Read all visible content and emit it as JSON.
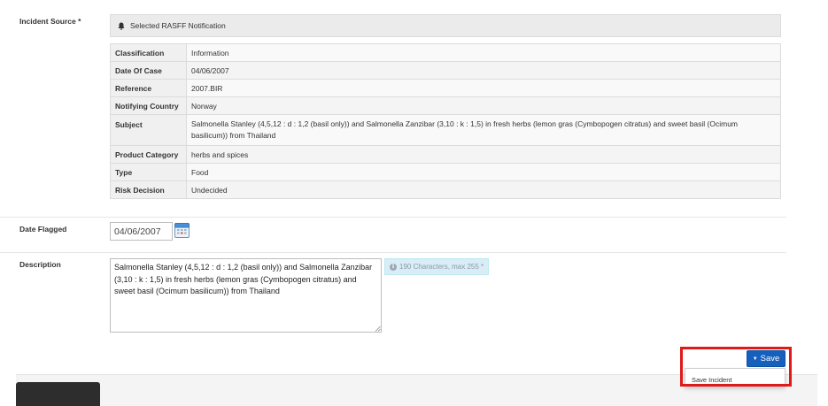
{
  "incident_source": {
    "label": "Incident Source *",
    "panel_title": "Selected RASFF Notification",
    "rows": [
      {
        "key": "Classification",
        "value": "Information"
      },
      {
        "key": "Date Of Case",
        "value": "04/06/2007"
      },
      {
        "key": "Reference",
        "value": "2007.BIR"
      },
      {
        "key": "Notifying Country",
        "value": "Norway"
      },
      {
        "key": "Subject",
        "value": "Salmonella Stanley (4,5,12 : d : 1,2 (basil only)) and Salmonella Zanzibar (3,10 : k : 1,5) in fresh herbs (lemon gras (Cymbopogen citratus) and sweet basil (Ocimum basilicum)) from Thailand"
      },
      {
        "key": "Product Category",
        "value": "herbs and spices"
      },
      {
        "key": "Type",
        "value": "Food"
      },
      {
        "key": "Risk Decision",
        "value": "Undecided"
      }
    ]
  },
  "date_flagged": {
    "label": "Date Flagged",
    "value": "04/06/2007"
  },
  "description": {
    "label": "Description",
    "value": "Salmonella Stanley (4,5,12 : d : 1,2 (basil only)) and Salmonella Zanzibar (3,10 : k : 1,5) in fresh herbs (lemon gras (Cymbopogen citratus) and sweet basil (Ocimum basilicum)) from Thailand",
    "counter": "190 Characters, max 255 *"
  },
  "actions": {
    "save_label": "Save",
    "menu_item": "Save Incident"
  },
  "colors": {
    "primary": "#1560bd",
    "highlight": "#e01919",
    "info_bg": "#d9edf7"
  }
}
